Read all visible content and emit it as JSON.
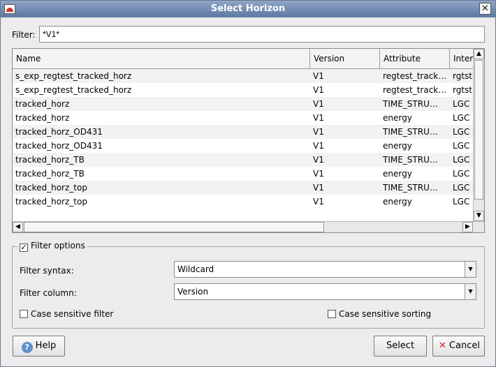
{
  "window": {
    "title": "Select Horizon"
  },
  "filter": {
    "label": "Filter:",
    "value": "*V1*"
  },
  "table": {
    "columns": [
      "Name",
      "Version",
      "Attribute",
      "Inter"
    ],
    "rows": [
      {
        "name": "s_exp_regtest_tracked_horz",
        "version": "V1",
        "attribute": "regtest_track…",
        "inter": "rgtst"
      },
      {
        "name": "s_exp_regtest_tracked_horz",
        "version": "V1",
        "attribute": "regtest_track…",
        "inter": "rgtst"
      },
      {
        "name": "tracked_horz",
        "version": "V1",
        "attribute": "TIME_STRU…",
        "inter": "LGC"
      },
      {
        "name": "tracked_horz",
        "version": "V1",
        "attribute": "energy",
        "inter": "LGC"
      },
      {
        "name": "tracked_horz_OD431",
        "version": "V1",
        "attribute": "TIME_STRU…",
        "inter": "LGC"
      },
      {
        "name": "tracked_horz_OD431",
        "version": "V1",
        "attribute": "energy",
        "inter": "LGC"
      },
      {
        "name": "tracked_horz_TB",
        "version": "V1",
        "attribute": "TIME_STRU…",
        "inter": "LGC"
      },
      {
        "name": "tracked_horz_TB",
        "version": "V1",
        "attribute": "energy",
        "inter": "LGC"
      },
      {
        "name": "tracked_horz_top",
        "version": "V1",
        "attribute": "TIME_STRU…",
        "inter": "LGC"
      },
      {
        "name": "tracked_horz_top",
        "version": "V1",
        "attribute": "energy",
        "inter": "LGC"
      }
    ]
  },
  "options": {
    "legend": "Filter options",
    "legend_checked": true,
    "syntax_label": "Filter syntax:",
    "syntax_value": "Wildcard",
    "column_label": "Filter column:",
    "column_value": "Version",
    "case_filter_label": "Case sensitive filter",
    "case_sort_label": "Case sensitive sorting"
  },
  "buttons": {
    "help": "Help",
    "select": "Select",
    "cancel": "Cancel"
  },
  "colors": {
    "titlebar": "#5b78a3",
    "row_alt": "#f2f2f2"
  }
}
